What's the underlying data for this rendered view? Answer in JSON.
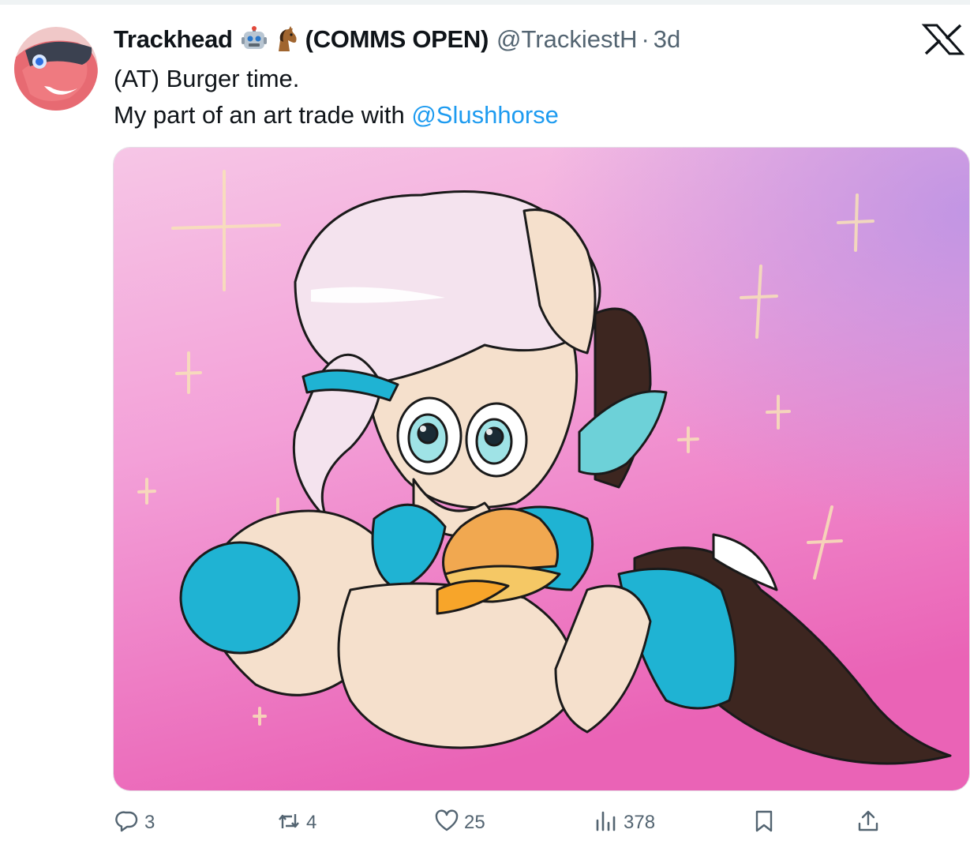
{
  "tweet": {
    "display_name": "Trackhead",
    "name_suffix": "(COMMS OPEN)",
    "emojis": [
      "robot-emoji",
      "horse-emoji"
    ],
    "handle": "@TrackiestH",
    "separator": "·",
    "time": "3d",
    "text_line1": "(AT) Burger time.",
    "text_line2_prefix": "My part of an art trade with ",
    "mention": "@Slushhorse"
  },
  "actions": {
    "replies": "3",
    "reposts": "4",
    "likes": "25",
    "views": "378"
  },
  "icons": {
    "reply": "reply-icon",
    "repost": "repost-icon",
    "like": "heart-icon",
    "views": "views-icon",
    "bookmark": "bookmark-icon",
    "share": "share-icon",
    "brand": "x-logo-icon"
  },
  "colors": {
    "text": "#0f1419",
    "secondary": "#536471",
    "link": "#1d9bf0",
    "media_pink": "#f08ad0"
  }
}
